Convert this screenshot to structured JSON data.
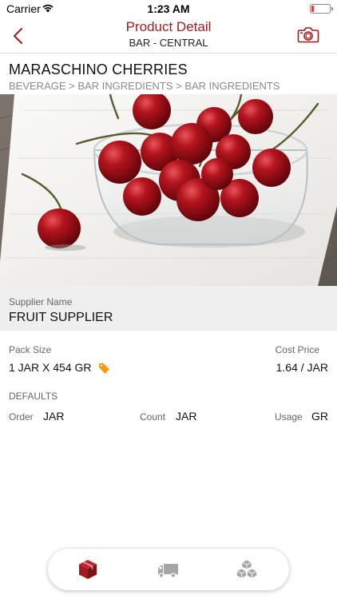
{
  "status_bar": {
    "carrier": "Carrier",
    "time": "1:23 AM"
  },
  "nav": {
    "title": "Product Detail",
    "subtitle": "BAR - CENTRAL"
  },
  "product": {
    "name": "MARASCHINO CHERRIES",
    "breadcrumb": "BEVERAGE > BAR INGREDIENTS > BAR INGREDIENTS"
  },
  "supplier": {
    "label": "Supplier Name",
    "value": "FRUIT SUPPLIER"
  },
  "pack": {
    "label": "Pack Size",
    "value": "1 JAR X 454 GR"
  },
  "cost": {
    "label": "Cost Price",
    "value": "1.64 / JAR"
  },
  "defaults": {
    "heading": "DEFAULTS",
    "order_label": "Order",
    "order_value": "JAR",
    "count_label": "Count",
    "count_value": "JAR",
    "usage_label": "Usage",
    "usage_value": "GR"
  },
  "tabs": [
    {
      "icon": "box-icon",
      "active": true
    },
    {
      "icon": "truck-icon",
      "active": false
    },
    {
      "icon": "boxes-stack-icon",
      "active": false
    }
  ],
  "colors": {
    "accent": "#9e1b1f",
    "tag": "#f39c12",
    "tab_inactive": "#a6a6a6",
    "supplier_bg": "#efefef"
  }
}
